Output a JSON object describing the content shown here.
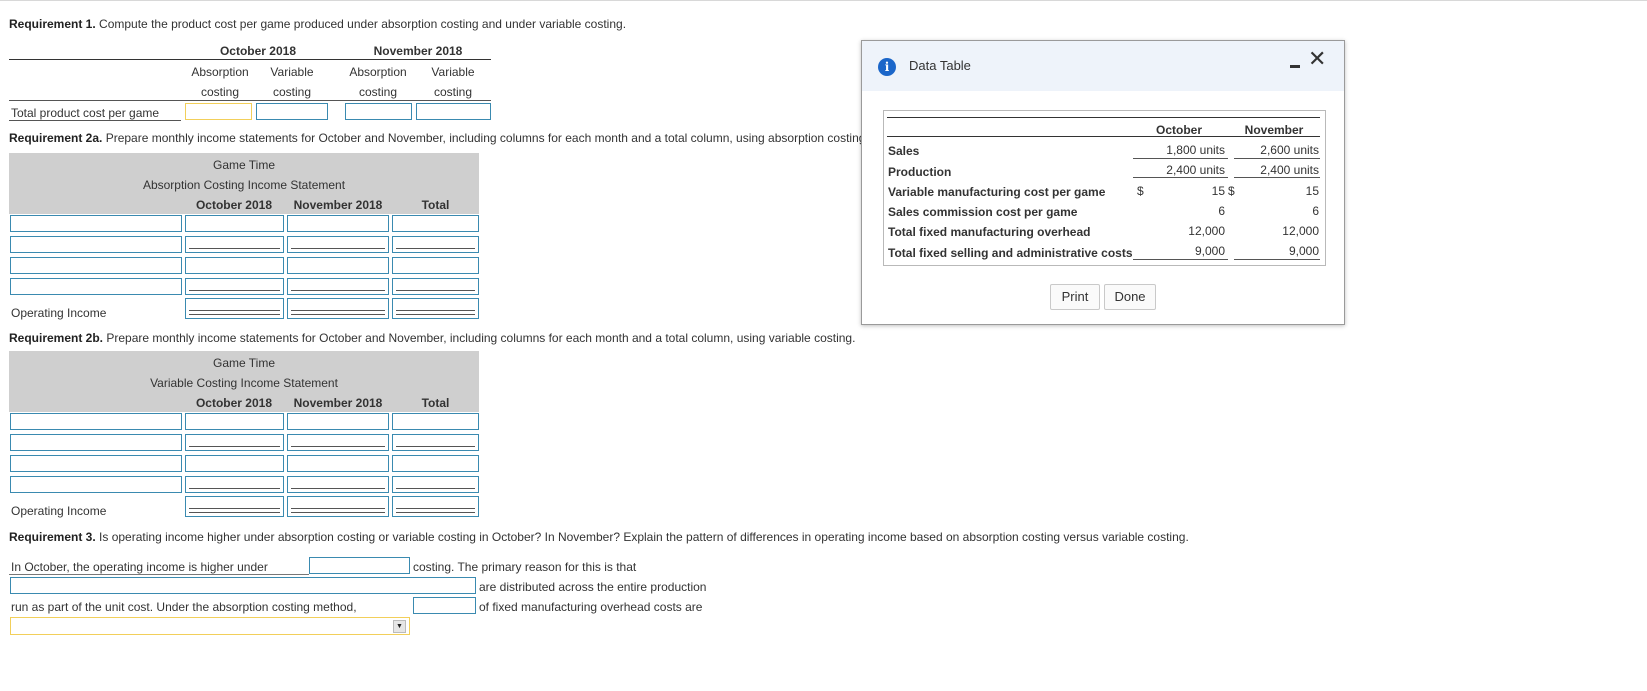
{
  "req1": {
    "label": "Requirement 1.",
    "text": " Compute the product cost per game produced under absorption costing and under variable costing.",
    "col_oct": "October 2018",
    "col_nov": "November 2018",
    "absorption": "Absorption",
    "variable": "Variable",
    "costing": "costing",
    "row_label": "Total product cost per game"
  },
  "req2a": {
    "label": "Requirement 2a.",
    "text": " Prepare monthly income statements for October and November, including columns for each month and a total column, using absorption costing.",
    "company": "Game Time",
    "statement": "Absorption Costing Income Statement",
    "col_oct": "October 2018",
    "col_nov": "November 2018",
    "col_total": "Total",
    "op_income": "Operating Income"
  },
  "req2b": {
    "label": "Requirement 2b.",
    "text": " Prepare monthly income statements for October and November, including columns for each month and a total column, using variable costing.",
    "company": "Game Time",
    "statement": "Variable Costing Income Statement",
    "col_oct": "October 2018",
    "col_nov": "November 2018",
    "col_total": "Total",
    "op_income": "Operating Income"
  },
  "req3": {
    "label": "Requirement 3.",
    "text": " Is operating income higher under absorption costing or variable costing in October? In November? Explain the pattern of differences in operating income based on absorption costing versus variable costing.",
    "line1a": "In October, the operating income is higher under",
    "line1b": "costing. The primary reason for this is that",
    "line2b": "are distributed across the entire production",
    "line3a": "run as part of the unit cost. Under the absorption costing method,",
    "line3b": "of fixed manufacturing overhead costs are"
  },
  "dialog": {
    "title": "Data Table",
    "col_oct": "October",
    "col_nov": "November",
    "rows": [
      {
        "label": "Sales",
        "dollar": "",
        "oct": "1,800 units",
        "dollar2": "",
        "nov": "2,600 units"
      },
      {
        "label": "Production",
        "dollar": "",
        "oct": "2,400 units",
        "dollar2": "",
        "nov": "2,400 units"
      },
      {
        "label": "Variable manufacturing cost per game",
        "dollar": "$",
        "oct": "15",
        "dollar2": "$",
        "nov": "15"
      },
      {
        "label": "Sales commission cost per game",
        "dollar": "",
        "oct": "6",
        "dollar2": "",
        "nov": "6"
      },
      {
        "label": "Total fixed manufacturing overhead",
        "dollar": "",
        "oct": "12,000",
        "dollar2": "",
        "nov": "12,000"
      },
      {
        "label": "Total fixed selling and administrative costs",
        "dollar": "",
        "oct": "9,000",
        "dollar2": "",
        "nov": "9,000"
      }
    ],
    "print_label": "Print",
    "done_label": "Done"
  }
}
